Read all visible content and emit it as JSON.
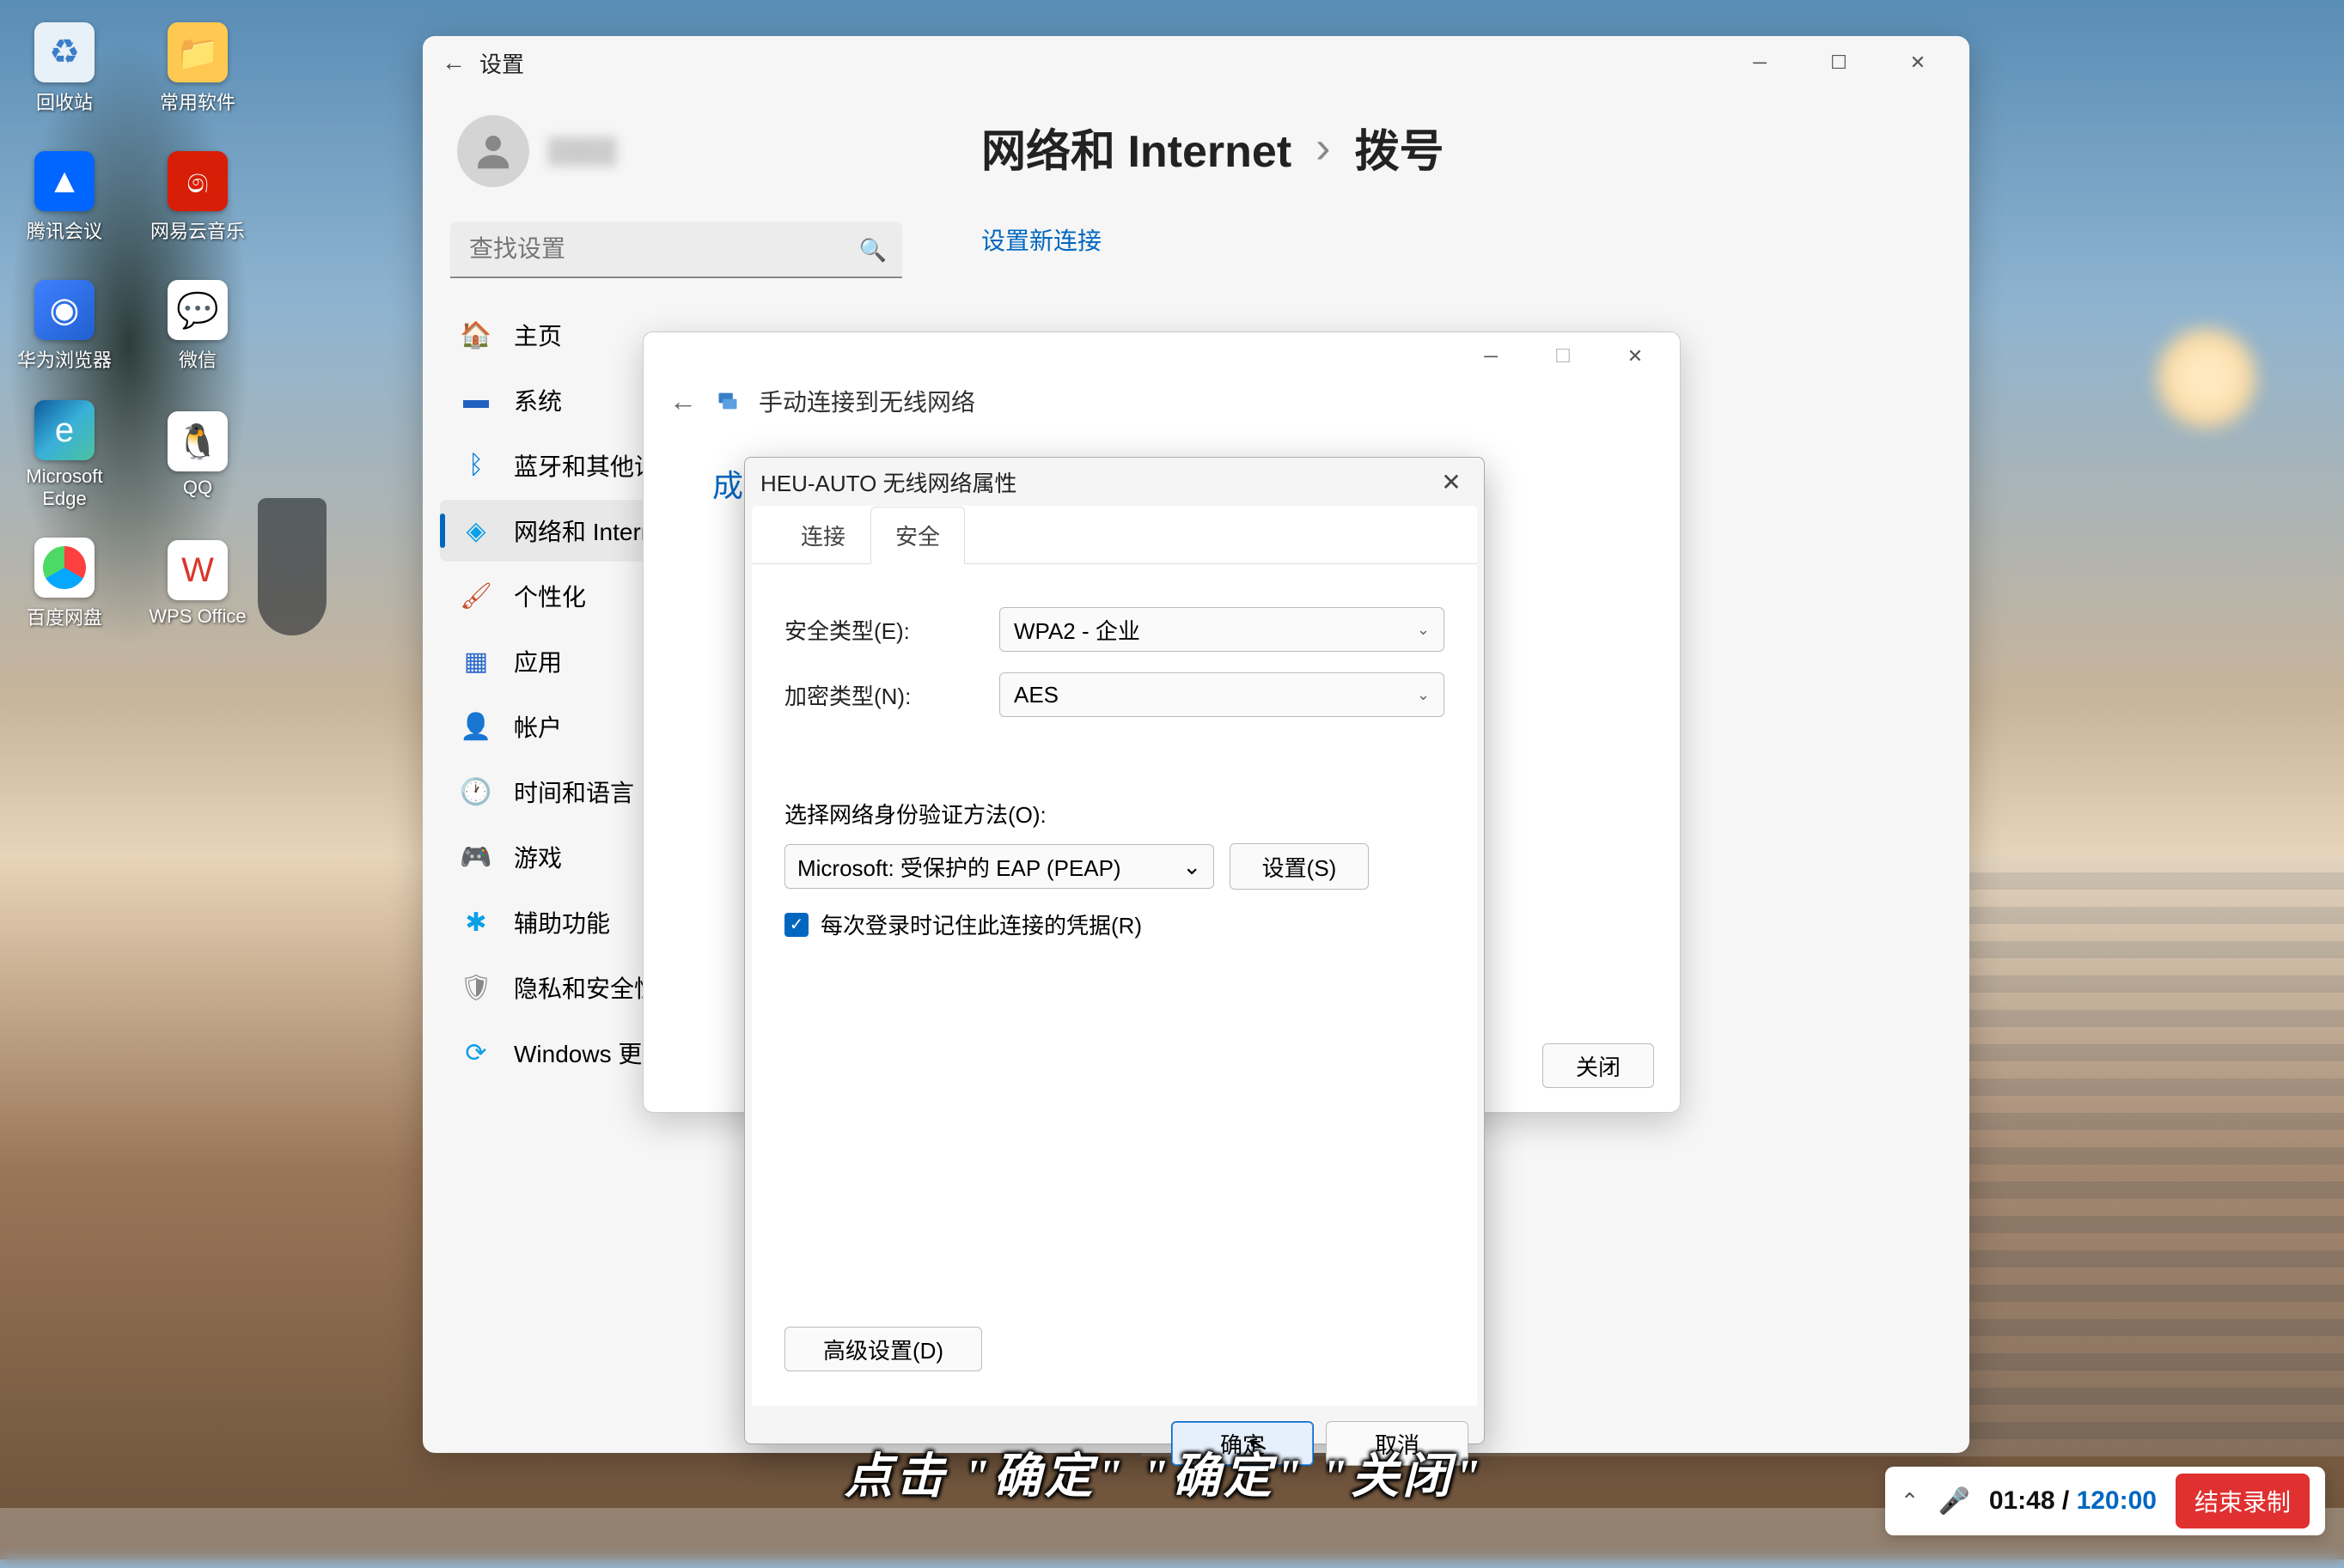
{
  "desktop_icons": {
    "recycle": "回收站",
    "folder": "常用软件",
    "tencent": "腾讯会议",
    "netease": "网易云音乐",
    "huawei": "华为浏览器",
    "wechat": "微信",
    "edge": "Microsoft Edge",
    "qq": "QQ",
    "baidu": "百度网盘",
    "wps": "WPS Office"
  },
  "settings_window": {
    "title": "设置",
    "search_placeholder": "查找设置",
    "breadcrumb_parent": "网络和 Internet",
    "breadcrumb_sep": "›",
    "breadcrumb_current": "拨号",
    "link_new": "设置新连接",
    "nav": {
      "home": "主页",
      "system": "系统",
      "bluetooth": "蓝牙和其他设备",
      "network": "网络和 Internet",
      "personal": "个性化",
      "apps": "应用",
      "account": "帐户",
      "time": "时间和语言",
      "gaming": "游戏",
      "access": "辅助功能",
      "privacy": "隐私和安全性",
      "update": "Windows 更新"
    }
  },
  "wizard": {
    "title": "手动连接到无线网络",
    "success_prefix": "成功",
    "close_btn": "关闭"
  },
  "prop_dialog": {
    "title": "HEU-AUTO 无线网络属性",
    "tab_connect": "连接",
    "tab_security": "安全",
    "sec_type_label": "安全类型(E):",
    "sec_type_value": "WPA2 - 企业",
    "enc_type_label": "加密类型(N):",
    "enc_type_value": "AES",
    "auth_label": "选择网络身份验证方法(O):",
    "auth_value": "Microsoft: 受保护的 EAP (PEAP)",
    "settings_btn": "设置(S)",
    "remember_label": "每次登录时记住此连接的凭据(R)",
    "advanced_btn": "高级设置(D)",
    "ok_btn": "确定",
    "cancel_btn": "取消"
  },
  "subtitle": "点击 \"确定\" \"确定\" \"关闭\"",
  "recording_bar": {
    "current": "01:48",
    "sep": " / ",
    "total": "120:00",
    "stop_btn": "结束录制"
  },
  "nav_icons": {
    "home": "🏠",
    "system": "🟦",
    "bluetooth_color": "#0078d4",
    "network_color": "#0aa0e8",
    "personal": "🖌️",
    "apps_color": "#2868c8",
    "account": "👤",
    "time": "🕐",
    "gaming": "🎮",
    "access_color": "#0aa0e8",
    "privacy": "🛡️",
    "update_color": "#0aa0e8"
  }
}
